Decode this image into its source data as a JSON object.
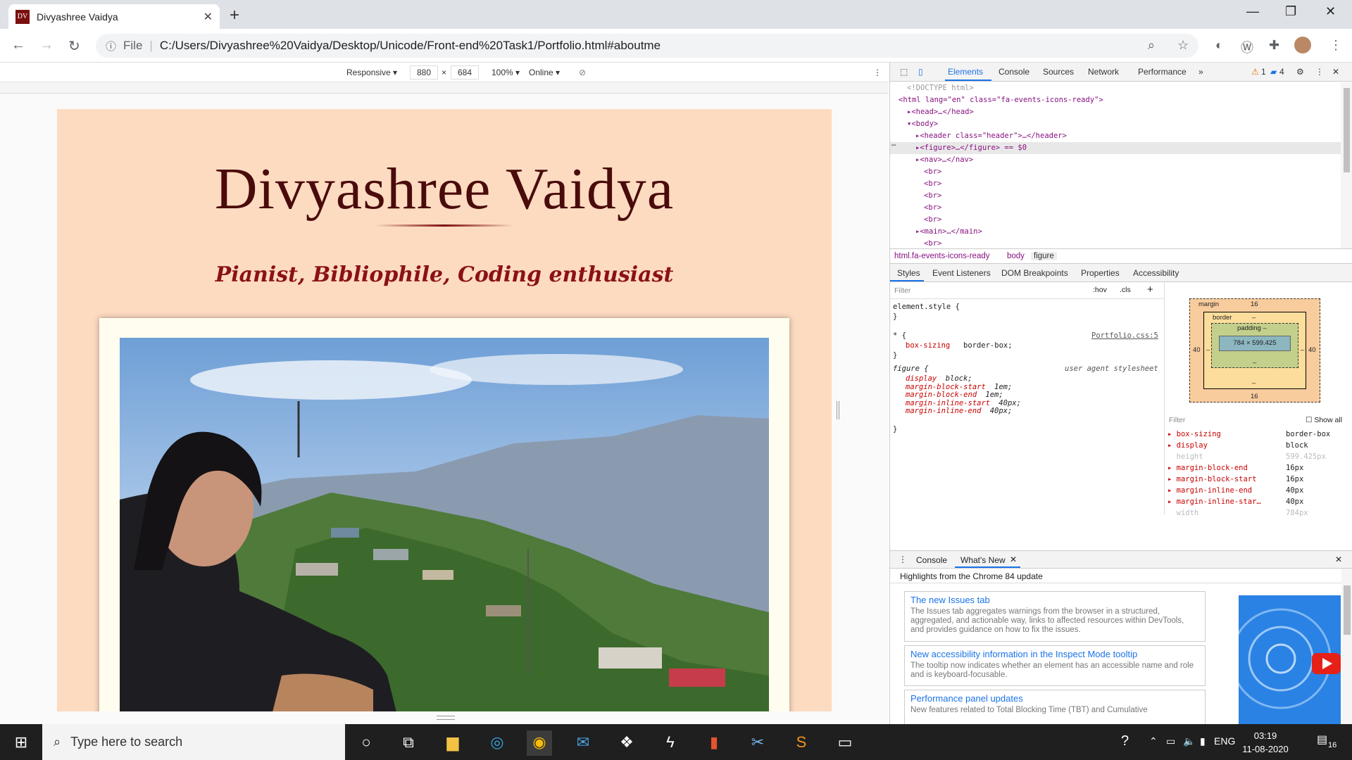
{
  "browser": {
    "tab_title": "Divyashree Vaidya",
    "tab_favicon_text": "DV",
    "address": {
      "file_label": "File",
      "url": "C:/Users/Divyashree%20Vaidya/Desktop/Unicode/Front-end%20Task1/Portfolio.html#aboutme"
    }
  },
  "device_toolbar": {
    "mode": "Responsive ▾",
    "width": "880",
    "height": "684",
    "zoom": "100% ▾",
    "network": "Online ▾"
  },
  "page": {
    "name": "Divyashree Vaidya",
    "tagline": "Pianist, Bibliophile, Coding enthusiast"
  },
  "devtools": {
    "tabs": [
      "Elements",
      "Console",
      "Sources",
      "Network",
      "Performance",
      "»"
    ],
    "warnings": "1",
    "messages": "4",
    "elements_tree": [
      {
        "indent": 1,
        "text": "<!DOCTYPE html>"
      },
      {
        "indent": 0,
        "text": "<html lang=\"en\" class=\"fa-events-icons-ready\">"
      },
      {
        "indent": 1,
        "text": "▸<head>…</head>"
      },
      {
        "indent": 1,
        "text": "▾<body>"
      },
      {
        "indent": 2,
        "text": "▸<header class=\"header\">…</header>"
      },
      {
        "indent": 2,
        "text": "▸<figure>…</figure> == $0"
      },
      {
        "indent": 2,
        "text": "▸<nav>…</nav>"
      },
      {
        "indent": 3,
        "text": "<br>"
      },
      {
        "indent": 3,
        "text": "<br>"
      },
      {
        "indent": 3,
        "text": "<br>"
      },
      {
        "indent": 3,
        "text": "<br>"
      },
      {
        "indent": 3,
        "text": "<br>"
      },
      {
        "indent": 2,
        "text": "▸<main>…</main>"
      },
      {
        "indent": 3,
        "text": "<br>"
      }
    ],
    "breadcrumbs": [
      "html.fa-events-icons-ready",
      "body",
      "figure"
    ],
    "pane_tabs": [
      "Styles",
      "Event Listeners",
      "DOM Breakpoints",
      "Properties",
      "Accessibility"
    ],
    "styles": {
      "filter_placeholder": "Filter",
      "hov": ":hov",
      "cls": ".cls",
      "element_style": "element.style {",
      "close_brace": "}",
      "universal_selector": "* {",
      "universal_source": "Portfolio.css:5",
      "universal_prop": "box-sizing",
      "universal_val": "border-box;",
      "figure_selector": "figure {",
      "figure_source": "user agent stylesheet",
      "figure_rules": [
        {
          "prop": "display",
          "val": "block;"
        },
        {
          "prop": "margin-block-start",
          "val": "1em;"
        },
        {
          "prop": "margin-block-end",
          "val": "1em;"
        },
        {
          "prop": "margin-inline-start",
          "val": "40px;"
        },
        {
          "prop": "margin-inline-end",
          "val": "40px;"
        }
      ]
    },
    "box_model": {
      "margin_label": "margin",
      "margin_top": "16",
      "margin_bottom": "16",
      "margin_left": "40",
      "margin_right": "40",
      "border_label": "border",
      "border_value": "–",
      "padding_label": "padding –",
      "padding_value": "–",
      "content": "784 × 599.425",
      "left_dash": "–",
      "right_dash": "–",
      "bottom_dash": "–"
    },
    "computed": {
      "filter_placeholder": "Filter",
      "show_all": "Show all",
      "rows": [
        {
          "k": "▸ box-sizing",
          "v": "border-box",
          "inherited": false
        },
        {
          "k": "▸ display",
          "v": "block",
          "inherited": false
        },
        {
          "k": "  height",
          "v": "599.425px",
          "inherited": true
        },
        {
          "k": "▸ margin-block-end",
          "v": "16px",
          "inherited": false
        },
        {
          "k": "▸ margin-block-start",
          "v": "16px",
          "inherited": false
        },
        {
          "k": "▸ margin-inline-end",
          "v": "40px",
          "inherited": false
        },
        {
          "k": "▸ margin-inline-star…",
          "v": "40px",
          "inherited": false
        },
        {
          "k": "  width",
          "v": "784px",
          "inherited": true
        }
      ]
    },
    "drawer": {
      "tabs": [
        "Console",
        "What's New"
      ],
      "headline": "Highlights from the Chrome 84 update",
      "cards": [
        {
          "title": "The new Issues tab",
          "body": "The Issues tab aggregates warnings from the browser in a structured, aggregated, and actionable way, links to affected resources within DevTools, and provides guidance on how to fix the issues."
        },
        {
          "title": "New accessibility information in the Inspect Mode tooltip",
          "body": "The tooltip now indicates whether an element has an accessible name and role and is keyboard-focusable."
        },
        {
          "title": "Performance panel updates",
          "body": "New features related to Total Blocking Time (TBT) and Cumulative"
        }
      ]
    }
  },
  "taskbar": {
    "search_placeholder": "Type here to search",
    "language": "ENG",
    "time": "03:19",
    "date": "11-08-2020",
    "notifications": "16"
  }
}
